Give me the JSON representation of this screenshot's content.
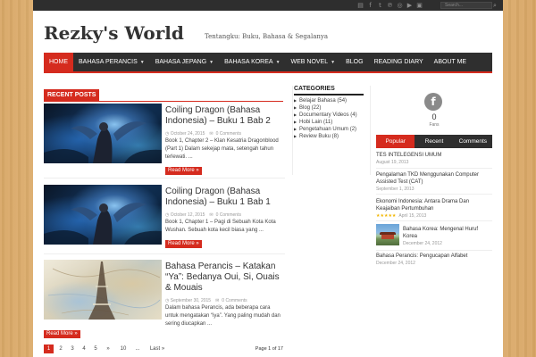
{
  "topbar": {
    "social_icons": [
      "rss-icon",
      "facebook-icon",
      "twitter-icon",
      "pinterest-icon",
      "dribbble-icon",
      "youtube-icon",
      "instagram-icon"
    ],
    "social_glyphs": [
      "▤",
      "f",
      "t",
      "℗",
      "◎",
      "▶",
      "▣"
    ],
    "search_placeholder": "Search...",
    "search_button_glyph": "⌕"
  },
  "header": {
    "site_title": "Rezky's World",
    "tagline": "Tentangku: Buku, Bahasa & Segalanya"
  },
  "nav": {
    "items": [
      {
        "label": "HOME",
        "has_dropdown": false,
        "active": true
      },
      {
        "label": "BAHASA PERANCIS",
        "has_dropdown": true,
        "active": false
      },
      {
        "label": "BAHASA JEPANG",
        "has_dropdown": true,
        "active": false
      },
      {
        "label": "BAHASA KOREA",
        "has_dropdown": true,
        "active": false
      },
      {
        "label": "WEB NOVEL",
        "has_dropdown": true,
        "active": false
      },
      {
        "label": "BLOG",
        "has_dropdown": false,
        "active": false
      },
      {
        "label": "READING DIARY",
        "has_dropdown": false,
        "active": false
      },
      {
        "label": "ABOUT ME",
        "has_dropdown": false,
        "active": false
      }
    ],
    "caret_glyph": "▼"
  },
  "recent_posts": {
    "heading": "RECENT POSTS",
    "posts": [
      {
        "title": "Coiling Dragon (Bahasa Indonesia) – Buku 1 Bab 2",
        "date": "October 24, 2015",
        "comments": "0 Comments",
        "excerpt": "Book 1, Chapter 2 – Klan Kesatria Dragonblood (Part 1) Dalam sekejap mata, setengah tahun terlewati. ...",
        "read_more": "Read More »",
        "thumb": "dragon"
      },
      {
        "title": "Coiling Dragon (Bahasa Indonesia) – Buku 1 Bab 1",
        "date": "October 12, 2015",
        "comments": "0 Comments",
        "excerpt": "Book 1, Chapter 1 – Pagi di Sebuah Kota Kota Wushan. Sebuah kota kecil biasa yang ...",
        "read_more": "Read More »",
        "thumb": "dragon"
      },
      {
        "title": "Bahasa Perancis – Katakan “Ya”: Bedanya Oui, Si, Ouais & Mouais",
        "date": "September 30, 2015",
        "comments": "0 Comments",
        "excerpt": "Dalam bahasa Perancis, ada beberapa cara untuk mengatakan “iya”. Yang paling mudah dan sering diucapkan ...",
        "read_more": "Read More »",
        "thumb": "map"
      }
    ]
  },
  "pagination": {
    "pages": [
      "1",
      "2",
      "3",
      "4",
      "5",
      "»",
      "10",
      "...",
      "Last »"
    ],
    "current": "1",
    "page_of": "Page 1 of 17"
  },
  "categories": {
    "heading": "CATEGORIES",
    "items": [
      "Belajar Bahasa (54)",
      "Blog (22)",
      "Documentary Videos (4)",
      "Hobi Lain (11)",
      "Pengetahuan Umum (2)",
      "Review Buku (8)"
    ]
  },
  "sidebar": {
    "facebook_glyph": "f",
    "fans_count": "0",
    "fans_label": "Fans",
    "tabs": [
      {
        "label": "Popular",
        "active": true
      },
      {
        "label": "Recent",
        "active": false
      },
      {
        "label": "Comments",
        "active": false
      }
    ],
    "popular": [
      {
        "title": "TES INTELEGENSI UMUM",
        "date": "August 19, 2013"
      },
      {
        "title": "Pengalaman TKD Menggunakan Computer Assisted Test (CAT)",
        "date": "September 1, 2013"
      },
      {
        "title": "Ekonomi Indonesia: Antara Drama Dan Keajaiban Pertumbuhan",
        "date": "April 15, 2013",
        "stars": "★★★★★"
      },
      {
        "title": "Bahasa Korea: Mengenal Huruf Korea",
        "date": "December 24, 2012"
      },
      {
        "title": "Bahasa Perancis: Pengucapan Alfabet",
        "date": "December 24, 2012"
      }
    ]
  }
}
